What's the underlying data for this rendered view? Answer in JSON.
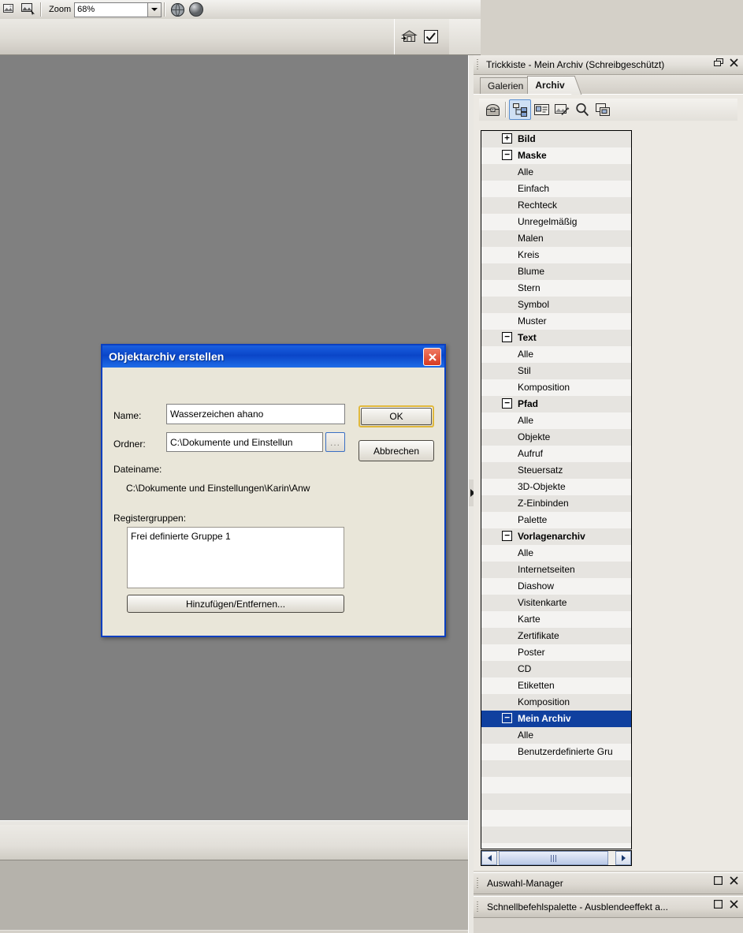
{
  "toolbar": {
    "zoom_label": "Zoom",
    "zoom_value": "68%",
    "icons": [
      "image-tool-icon",
      "crop-tool-icon",
      "globe-icon",
      "sphere-icon"
    ],
    "row2_icons": [
      "archive-import-icon",
      "checkmark-box-icon"
    ]
  },
  "dialog": {
    "title": "Objektarchiv erstellen",
    "close_label": "✕",
    "name_label": "Name:",
    "name_value": "Wasserzeichen ahano",
    "folder_label": "Ordner:",
    "folder_value": "C:\\Dokumente und Einstellun",
    "browse_label": "...",
    "filename_label": "Dateiname:",
    "filename_value": "C:\\Dokumente und Einstellungen\\Karin\\Anw",
    "groups_label": "Registergruppen:",
    "group_items": [
      "Frei definierte Gruppe 1"
    ],
    "add_remove_label": "Hinzufügen/Entfernen...",
    "ok_label": "OK",
    "cancel_label": "Abbrechen"
  },
  "archive_panel": {
    "title": "Trickkiste - Mein Archiv (Schreibgeschützt)",
    "restore_label": "❐",
    "close_label": "✕",
    "tabs": [
      {
        "label": "Galerien",
        "active": false
      },
      {
        "label": "Archiv",
        "active": true
      }
    ],
    "toolbar_icons": [
      "archive-chest-icon",
      "tree-view-icon",
      "details-view-icon",
      "thumbnail-view-icon",
      "search-icon",
      "copy-icon"
    ],
    "tree": [
      {
        "label": "Bild",
        "type": "group",
        "expander": "+"
      },
      {
        "label": "Maske",
        "type": "group",
        "expander": "−"
      },
      {
        "label": "Alle",
        "type": "child"
      },
      {
        "label": "Einfach",
        "type": "child"
      },
      {
        "label": "Rechteck",
        "type": "child"
      },
      {
        "label": "Unregelmäßig",
        "type": "child"
      },
      {
        "label": "Malen",
        "type": "child"
      },
      {
        "label": "Kreis",
        "type": "child"
      },
      {
        "label": "Blume",
        "type": "child"
      },
      {
        "label": "Stern",
        "type": "child"
      },
      {
        "label": "Symbol",
        "type": "child"
      },
      {
        "label": "Muster",
        "type": "child"
      },
      {
        "label": "Text",
        "type": "group",
        "expander": "−"
      },
      {
        "label": "Alle",
        "type": "child"
      },
      {
        "label": "Stil",
        "type": "child"
      },
      {
        "label": "Komposition",
        "type": "child"
      },
      {
        "label": "Pfad",
        "type": "group",
        "expander": "−"
      },
      {
        "label": "Alle",
        "type": "child"
      },
      {
        "label": "Objekte",
        "type": "child"
      },
      {
        "label": "Aufruf",
        "type": "child"
      },
      {
        "label": "Steuersatz",
        "type": "child"
      },
      {
        "label": "3D-Objekte",
        "type": "child"
      },
      {
        "label": "Z-Einbinden",
        "type": "child"
      },
      {
        "label": "Palette",
        "type": "child"
      },
      {
        "label": "Vorlagenarchiv",
        "type": "group",
        "expander": "−"
      },
      {
        "label": "Alle",
        "type": "child"
      },
      {
        "label": "Internetseiten",
        "type": "child"
      },
      {
        "label": "Diashow",
        "type": "child"
      },
      {
        "label": "Visitenkarte",
        "type": "child"
      },
      {
        "label": "Karte",
        "type": "child"
      },
      {
        "label": "Zertifikate",
        "type": "child"
      },
      {
        "label": "Poster",
        "type": "child"
      },
      {
        "label": "CD",
        "type": "child"
      },
      {
        "label": "Etiketten",
        "type": "child"
      },
      {
        "label": "Komposition",
        "type": "child"
      },
      {
        "label": "Mein Archiv",
        "type": "group",
        "expander": "−",
        "selected": true
      },
      {
        "label": "Alle",
        "type": "child"
      },
      {
        "label": "Benutzerdefinierte Gru",
        "type": "child"
      }
    ],
    "scroll": {
      "left_arrow": "◀",
      "right_arrow": "▶"
    }
  },
  "docked_panels": [
    {
      "title": "Auswahl-Manager",
      "restore_label": "❐",
      "close_label": "✕"
    },
    {
      "title": "Schnellbefehlspalette - Ausblendeeffekt a...",
      "restore_label": "❐",
      "close_label": "✕"
    }
  ],
  "colors": {
    "canvas": "#808080",
    "dialog_face": "#e9e6d9",
    "dialog_border": "#0a3fc0",
    "titlebar_blue": "#0a45c8",
    "selection_blue": "#10409f",
    "close_red": "#d63a21",
    "focus_gold": "#e0b83c",
    "chrome": "#d7d3cc"
  }
}
